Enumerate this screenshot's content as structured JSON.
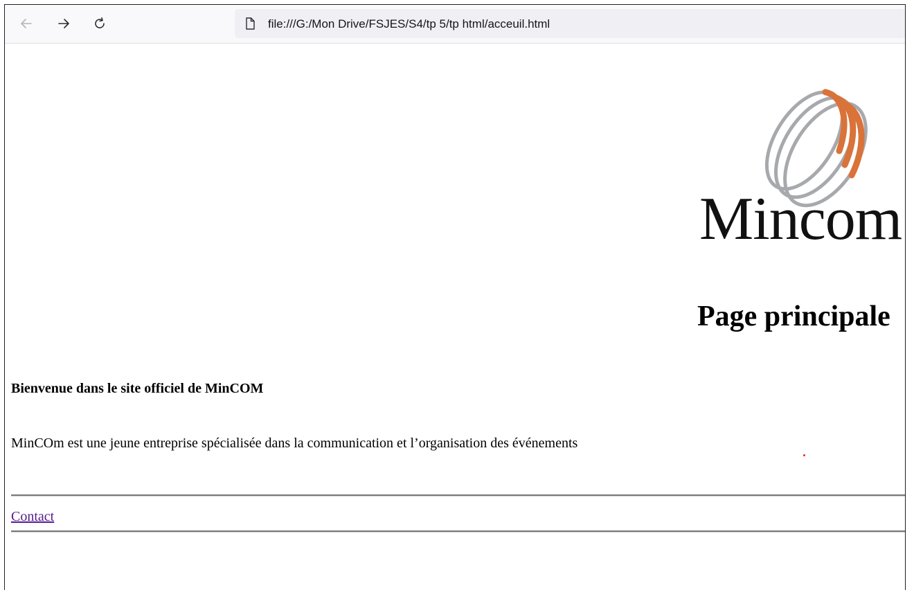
{
  "browser": {
    "back_icon": "arrow-left-icon",
    "forward_icon": "arrow-right-icon",
    "reload_icon": "reload-icon",
    "page_icon": "document-icon",
    "url": "file:///G:/Mon Drive/FSJES/S4/tp 5/tp html/acceuil.html"
  },
  "page": {
    "logo": {
      "wordmark": "Mincom",
      "colors": {
        "rings_gray": "#a7a9ac",
        "rings_orange": "#d9733a"
      }
    },
    "title": "Page principale",
    "welcome": "Bienvenue dans le site officiel de MinCOM",
    "description": "MinCOm est une jeune entreprise spécialisée dans la communication et l’organisation des événements",
    "contact_link": "Contact",
    "link_color": "#551a8b"
  }
}
